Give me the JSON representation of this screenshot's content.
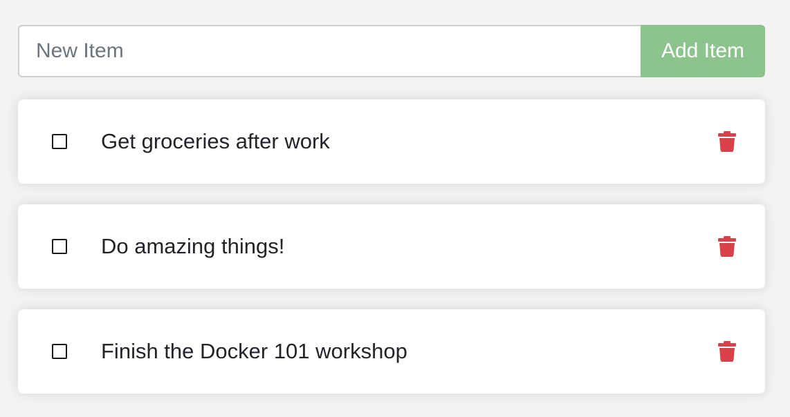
{
  "add_form": {
    "input_placeholder": "New Item",
    "input_value": "",
    "button_label": "Add Item"
  },
  "items": [
    {
      "name": "Get groceries after work",
      "completed": false
    },
    {
      "name": "Do amazing things!",
      "completed": false
    },
    {
      "name": "Finish the Docker 101 workshop",
      "completed": false
    }
  ],
  "colors": {
    "background": "#f3f3f3",
    "add_button": "#8dc38c",
    "trash_icon": "#d9414a",
    "text": "#212529"
  },
  "icons": {
    "checkbox": "checkbox-unchecked-icon",
    "delete": "trash-icon"
  }
}
